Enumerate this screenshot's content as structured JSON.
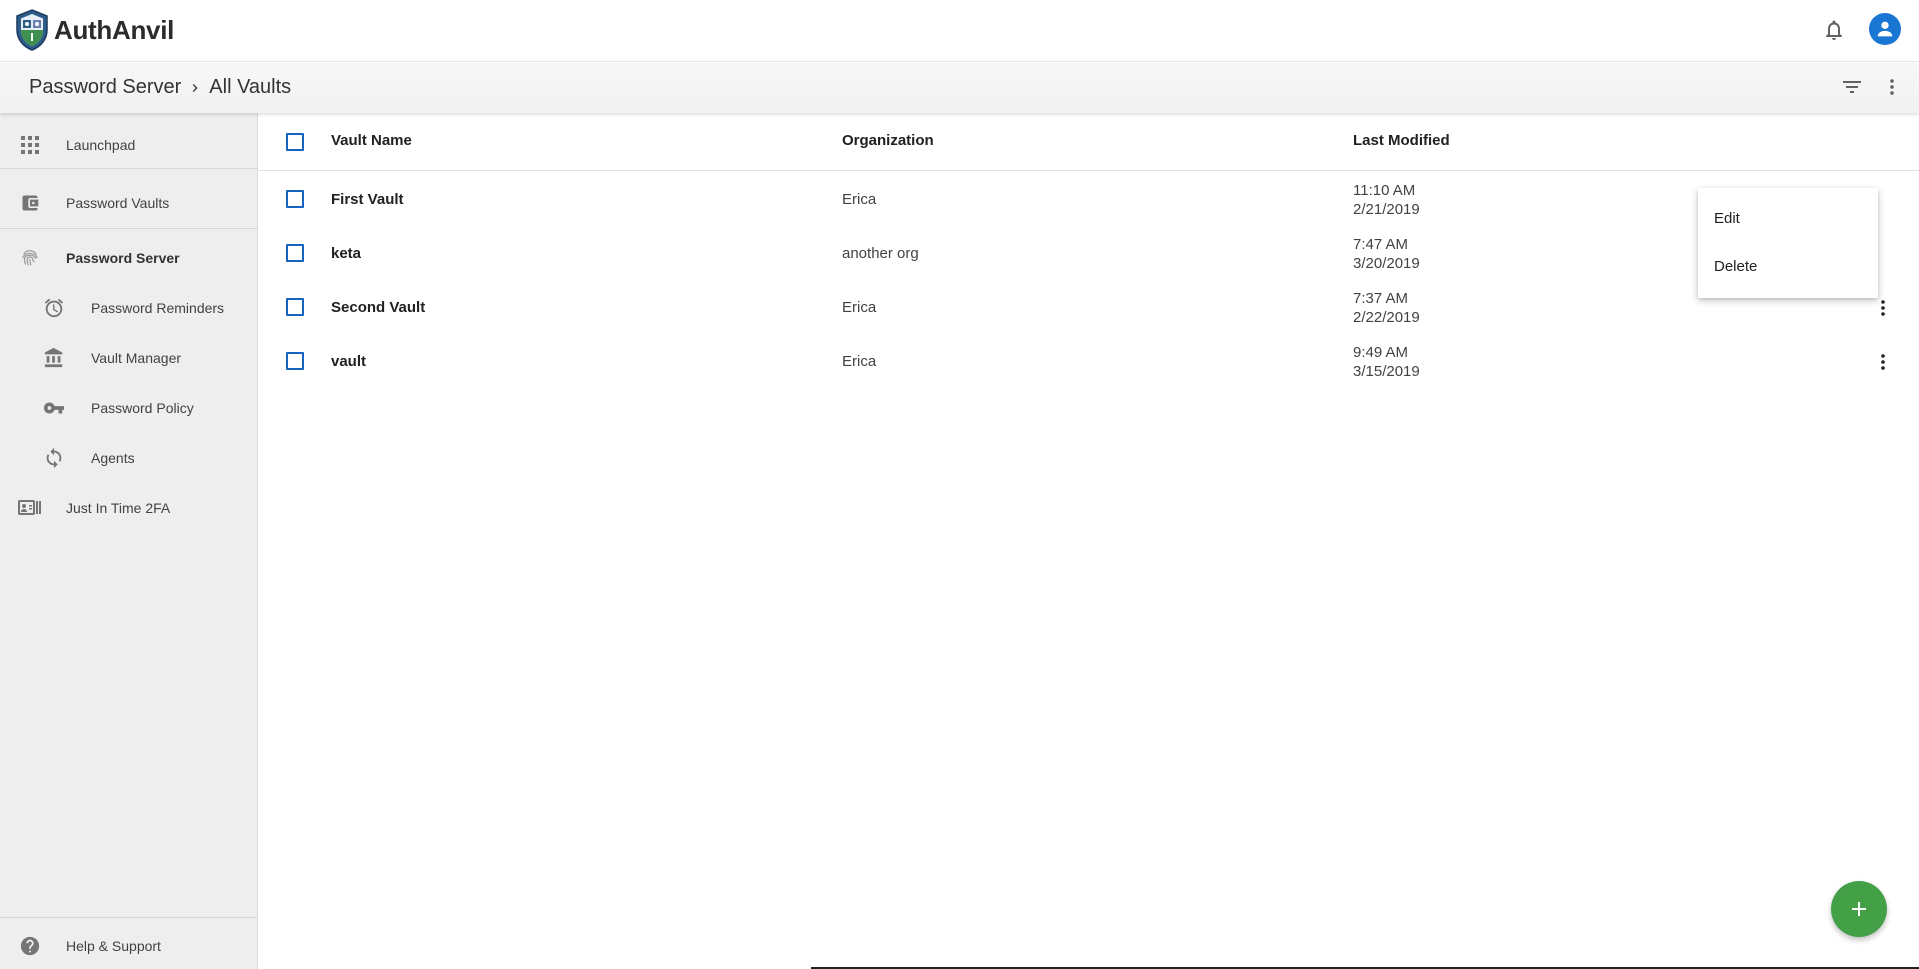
{
  "app": {
    "name": "AuthAnvil"
  },
  "breadcrumb": {
    "parent": "Password Server",
    "current": "All Vaults"
  },
  "header_icons": [
    "bell-icon",
    "user-avatar-icon",
    "filter-icon",
    "more-vert-icon"
  ],
  "sidebar": {
    "items": [
      {
        "label": "Launchpad",
        "icon": "apps-grid-icon"
      },
      {
        "label": "Password Vaults",
        "icon": "wallet-icon"
      },
      {
        "label": "Password Server",
        "icon": "fingerprint-icon",
        "active": true
      },
      {
        "label": "Password Reminders",
        "icon": "alarm-icon"
      },
      {
        "label": "Vault Manager",
        "icon": "bank-icon"
      },
      {
        "label": "Password Policy",
        "icon": "key-icon"
      },
      {
        "label": "Agents",
        "icon": "sync-icon"
      },
      {
        "label": "Just In Time 2FA",
        "icon": "contact-card-icon"
      }
    ],
    "footer": {
      "label": "Help & Support",
      "icon": "help-icon"
    }
  },
  "table": {
    "columns": [
      "Vault Name",
      "Organization",
      "Last Modified"
    ],
    "rows": [
      {
        "name": "First Vault",
        "organization": "Erica",
        "time": "11:10 AM",
        "date": "2/21/2019"
      },
      {
        "name": "keta",
        "organization": "another org",
        "time": "7:47 AM",
        "date": "3/20/2019"
      },
      {
        "name": "Second Vault",
        "organization": "Erica",
        "time": "7:37 AM",
        "date": "2/22/2019"
      },
      {
        "name": "vault",
        "organization": "Erica",
        "time": "9:49 AM",
        "date": "3/15/2019"
      }
    ]
  },
  "context_menu": {
    "items": [
      "Edit",
      "Delete"
    ]
  },
  "fab": {
    "icon": "plus-icon",
    "color": "#43a047"
  },
  "colors": {
    "accent": "#1565c0",
    "avatar": "#1976d2",
    "fab": "#43a047"
  }
}
